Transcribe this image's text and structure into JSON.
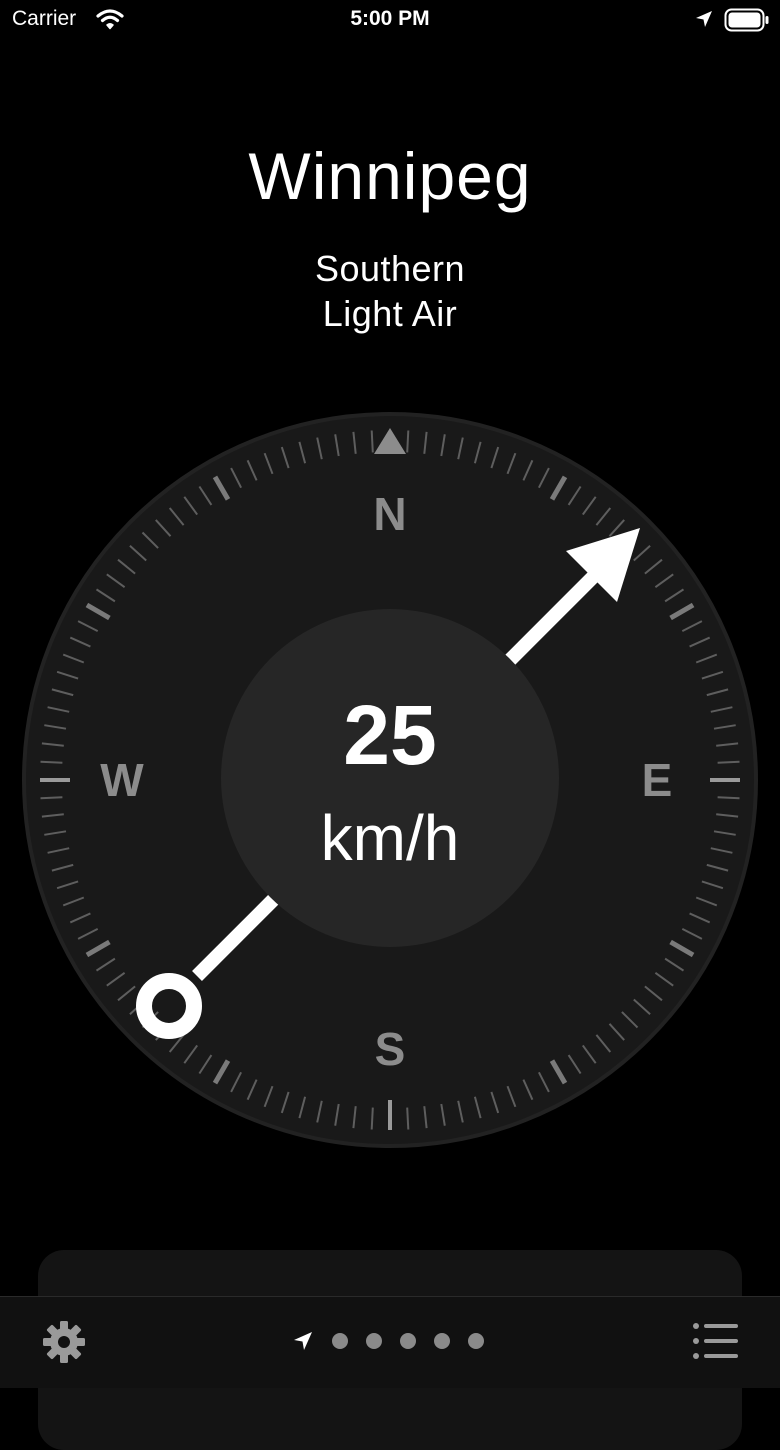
{
  "status_bar": {
    "carrier": "Carrier",
    "time": "5:00 PM"
  },
  "header": {
    "city": "Winnipeg",
    "direction": "Southern",
    "descriptor": "Light Air"
  },
  "compass": {
    "cardinals": {
      "north": "N",
      "east": "E",
      "south": "S",
      "west": "W"
    },
    "speed_value": "25",
    "speed_unit": "km/h",
    "wind_arrow_bearing_deg": 45
  },
  "toolbar": {
    "icons": [
      "gear-icon",
      "location-arrow-icon",
      "list-icon"
    ],
    "page_count": 5
  },
  "colors": {
    "background": "#000000",
    "dial": "#191919",
    "center_disc": "#262626",
    "tick": "#6e6e6e",
    "cardinal": "#8c8c8c",
    "arrow": "#ffffff"
  }
}
